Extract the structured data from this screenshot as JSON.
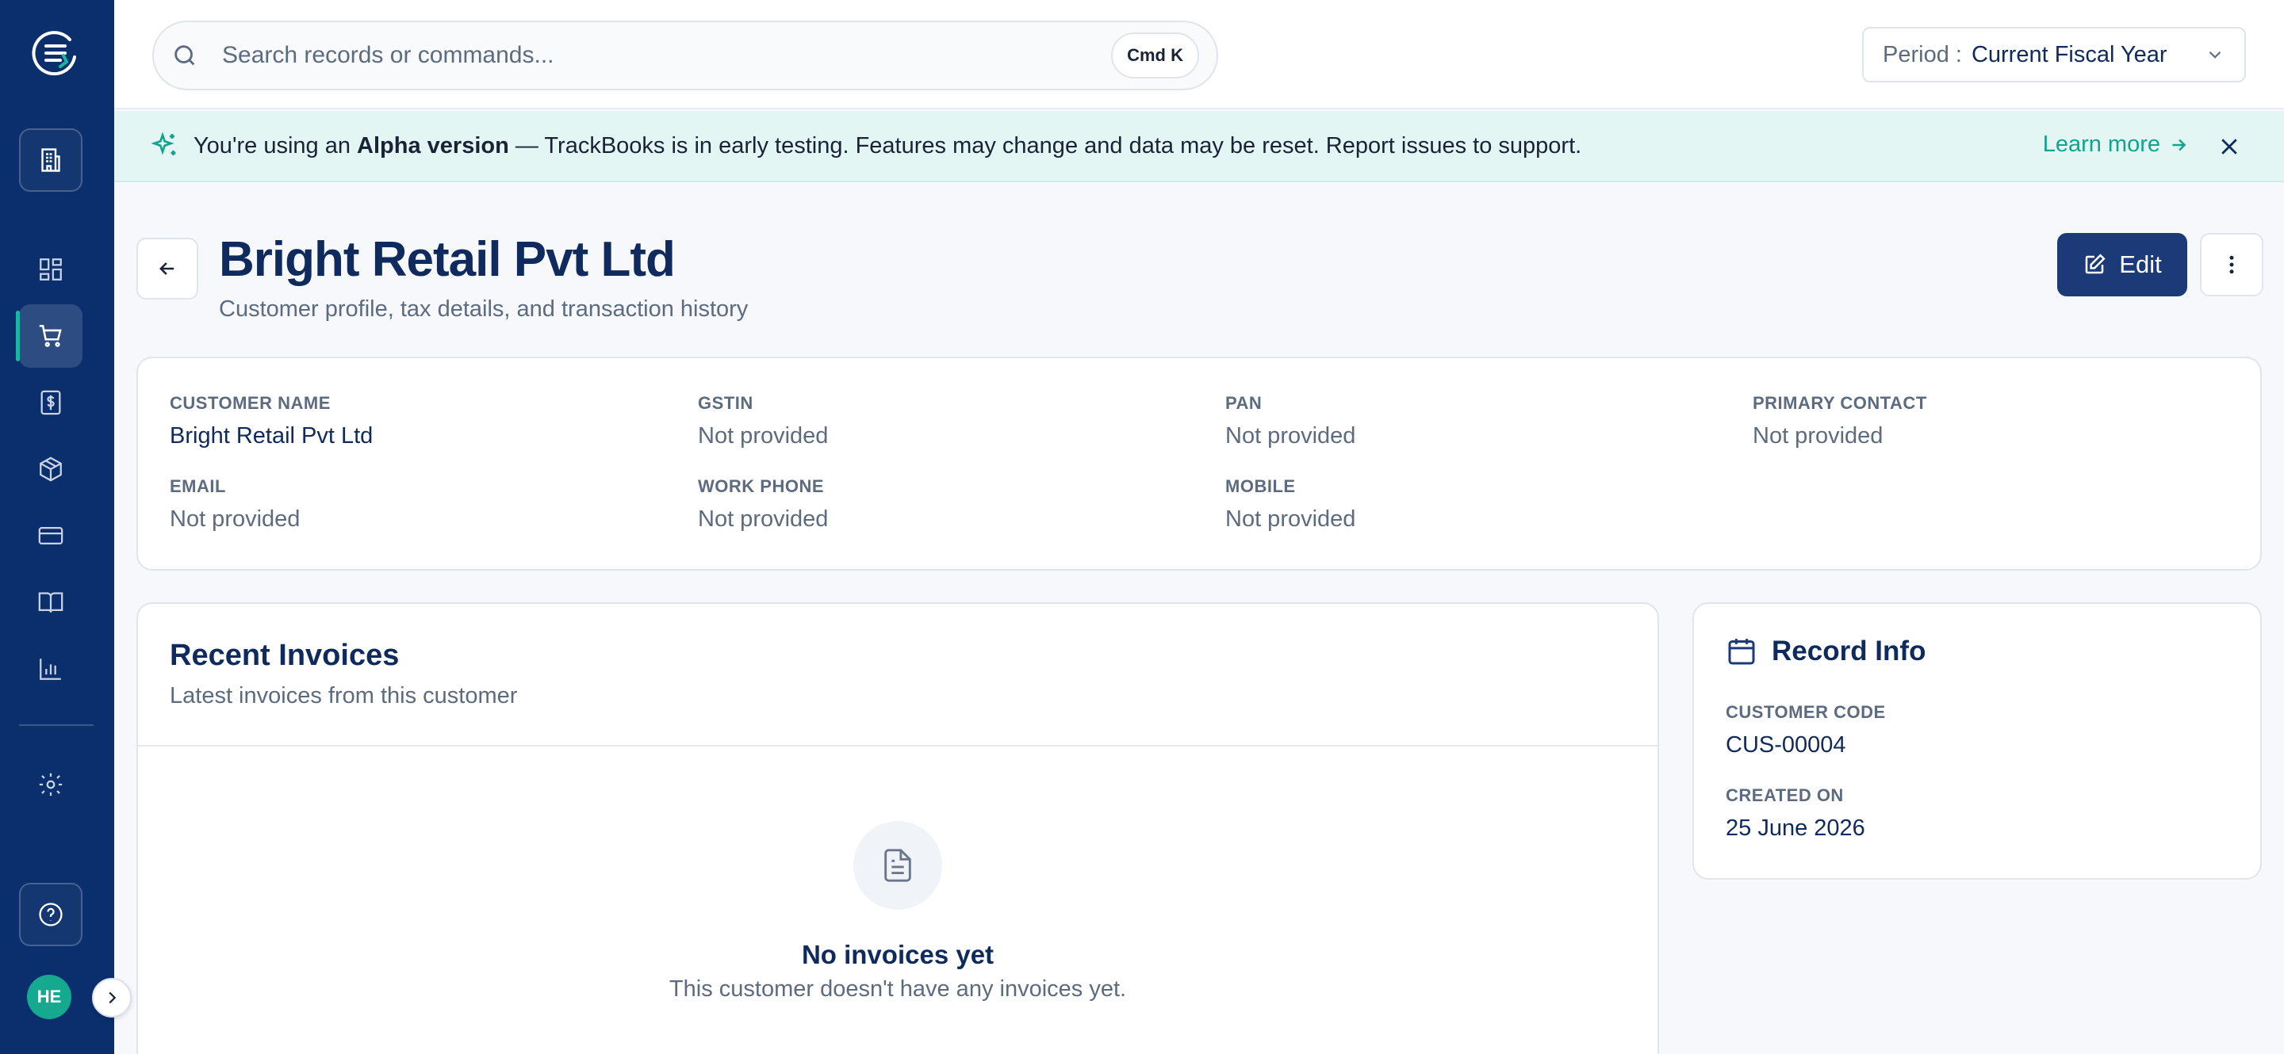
{
  "sidebar": {
    "items": [
      {
        "name": "buildings",
        "icon": "building-icon",
        "boxed": true
      },
      {
        "name": "dashboard",
        "icon": "dashboard-grid-icon"
      },
      {
        "name": "sales",
        "icon": "shopping-cart-icon",
        "active": true
      },
      {
        "name": "billing",
        "icon": "dollar-receipt-icon"
      },
      {
        "name": "inventory",
        "icon": "package-box-icon"
      },
      {
        "name": "payments",
        "icon": "credit-card-icon"
      },
      {
        "name": "accounting",
        "icon": "book-open-icon"
      },
      {
        "name": "reports",
        "icon": "bar-chart-icon"
      },
      {
        "name": "settings",
        "icon": "gear-icon"
      }
    ],
    "help_icon": "help-circle-icon",
    "avatar_initials": "HE"
  },
  "topbar": {
    "search_placeholder": "Search records or commands...",
    "shortcut": "Cmd K",
    "period_label": "Period :",
    "period_value": "Current Fiscal Year"
  },
  "banner": {
    "prefix": "You're using an ",
    "highlight": "Alpha version",
    "suffix": " — TrackBooks is in early testing. Features may change and data may be reset. Report issues to support.",
    "link": "Learn more"
  },
  "header": {
    "title": "Bright Retail Pvt Ltd",
    "subtitle": "Customer profile, tax details, and transaction history",
    "edit_label": "Edit"
  },
  "details": {
    "customer_name": {
      "label": "CUSTOMER NAME",
      "value": "Bright Retail Pvt Ltd"
    },
    "gstin": {
      "label": "GSTIN",
      "value": "Not provided"
    },
    "pan": {
      "label": "PAN",
      "value": "Not provided"
    },
    "primary_contact": {
      "label": "PRIMARY CONTACT",
      "value": "Not provided"
    },
    "email": {
      "label": "EMAIL",
      "value": "Not provided"
    },
    "work_phone": {
      "label": "WORK PHONE",
      "value": "Not provided"
    },
    "mobile": {
      "label": "MOBILE",
      "value": "Not provided"
    }
  },
  "invoices": {
    "title": "Recent Invoices",
    "subtitle": "Latest invoices from this customer",
    "empty_title": "No invoices yet",
    "empty_sub": "This customer doesn't have any invoices yet."
  },
  "record_info": {
    "title": "Record Info",
    "customer_code": {
      "label": "CUSTOMER CODE",
      "value": "CUS-00004"
    },
    "created_on": {
      "label": "CREATED ON",
      "value": "25 June 2026"
    }
  },
  "colors": {
    "sidebar": "#0b2f6d",
    "accent_teal": "#13a38c",
    "primary_button": "#1c3a78",
    "banner_bg": "#e3f6f4"
  }
}
